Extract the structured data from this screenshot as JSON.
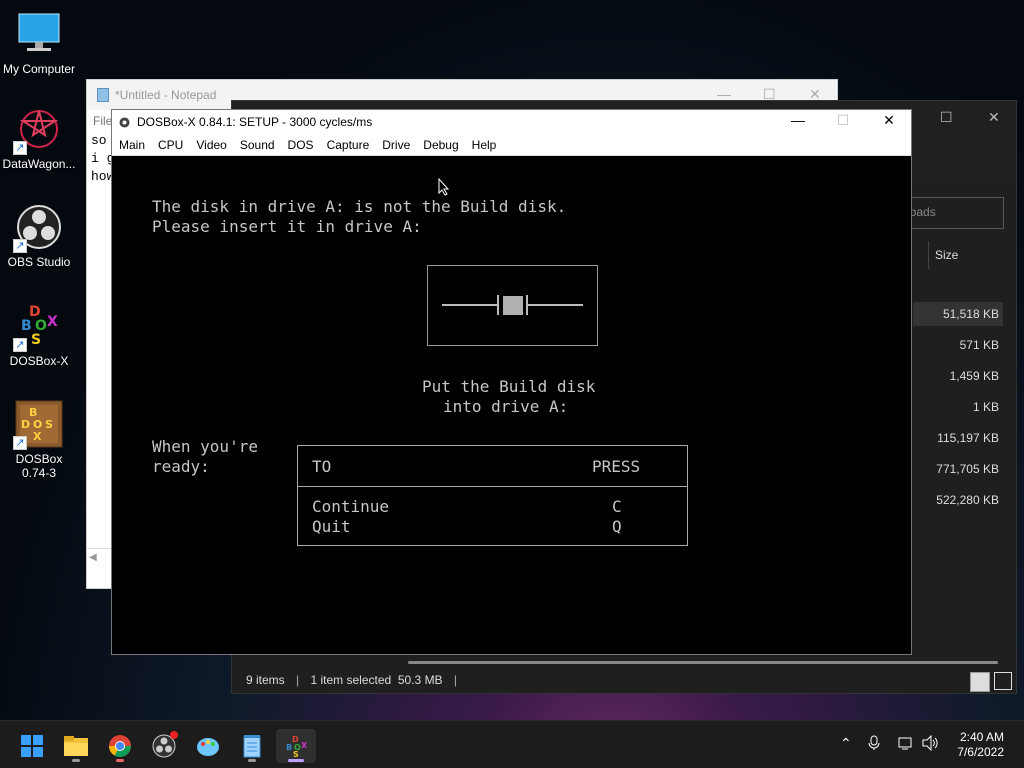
{
  "desktop": {
    "icons": [
      {
        "label": "My Computer"
      },
      {
        "label": "DataWagon..."
      },
      {
        "label": "OBS Studio"
      },
      {
        "label": "DOSBox-X"
      },
      {
        "label": "DOSBox\n0.74-3"
      }
    ]
  },
  "notepad": {
    "title": "*Untitled - Notepad",
    "menu_file": "File",
    "lines": [
      "so",
      "i g",
      "how"
    ]
  },
  "explorer": {
    "search_placeholder": "loads",
    "size_header": "Size",
    "sizes": [
      "51,518 KB",
      "571 KB",
      "1,459 KB",
      "1 KB",
      "115,197 KB",
      "771,705 KB",
      "522,280 KB"
    ],
    "status_items": "9 items",
    "status_selected": "1 item selected  50.3 MB"
  },
  "dosbox": {
    "title": "DOSBox-X 0.84.1: SETUP - 3000 cycles/ms",
    "menu": [
      "Main",
      "CPU",
      "Video",
      "Sound",
      "DOS",
      "Capture",
      "Drive",
      "Debug",
      "Help"
    ],
    "screen": {
      "line1": "The disk in drive A: is not the Build disk.",
      "line2": "Please insert it in drive A:",
      "put1": "Put the Build disk",
      "put2": "into drive A:",
      "ready1": "When you're",
      "ready2": "ready:",
      "col_to": "TO",
      "col_press": "PRESS",
      "opt1_label": "Continue",
      "opt1_key": "C",
      "opt2_label": "Quit",
      "opt2_key": "Q"
    }
  },
  "taskbar": {
    "time": "2:40 AM",
    "date": "7/6/2022"
  },
  "colors": {
    "accent": "#0078d4",
    "dos_text": "#c6c6c6"
  }
}
